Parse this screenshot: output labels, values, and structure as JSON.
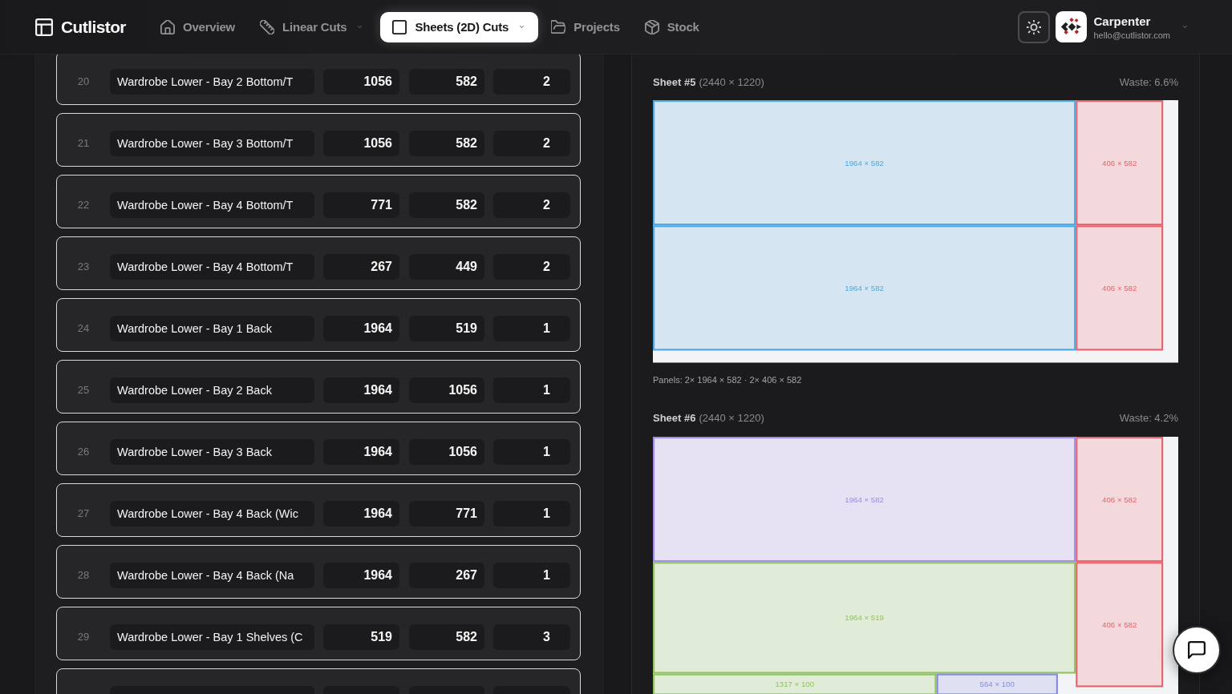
{
  "app": {
    "name": "Cutlistor"
  },
  "nav": [
    {
      "label": "Overview",
      "selected": false,
      "has_menu": false
    },
    {
      "label": "Linear Cuts",
      "selected": false,
      "has_menu": true
    },
    {
      "label": "Sheets (2D) Cuts",
      "selected": true,
      "has_menu": true
    },
    {
      "label": "Projects",
      "selected": false,
      "has_menu": false
    },
    {
      "label": "Stock",
      "selected": false,
      "has_menu": false
    }
  ],
  "user": {
    "name": "Carpenter",
    "email": "hello@cutlistor.com"
  },
  "cut_list": {
    "rows": [
      {
        "kind": "full",
        "number": "20",
        "column_1": "Wardrobe Lower - Bay 2 Bottom/T",
        "column_2": "1056",
        "column_3": "582",
        "column_4": "2"
      },
      {
        "kind": "full",
        "number": "21",
        "column_1": "Wardrobe Lower - Bay 3 Bottom/T",
        "column_2": "1056",
        "column_3": "582",
        "column_4": "2"
      },
      {
        "kind": "full",
        "number": "22",
        "column_1": "Wardrobe Lower - Bay 4 Bottom/T",
        "column_2": "771",
        "column_3": "582",
        "column_4": "2"
      },
      {
        "kind": "full",
        "number": "23",
        "column_1": "Wardrobe Lower - Bay 4 Bottom/T",
        "column_2": "267",
        "column_3": "449",
        "column_4": "2"
      },
      {
        "kind": "full",
        "number": "24",
        "column_1": "Wardrobe Lower - Bay 1 Back",
        "column_2": "1964",
        "column_3": "519",
        "column_4": "1"
      },
      {
        "kind": "full",
        "number": "25",
        "column_1": "Wardrobe Lower - Bay 2 Back",
        "column_2": "1964",
        "column_3": "1056",
        "column_4": "1"
      },
      {
        "kind": "full",
        "number": "26",
        "column_1": "Wardrobe Lower - Bay 3 Back",
        "column_2": "1964",
        "column_3": "1056",
        "column_4": "1"
      },
      {
        "kind": "full",
        "number": "27",
        "column_1": "Wardrobe Lower - Bay 4 Back (Wic",
        "column_2": "1964",
        "column_3": "771",
        "column_4": "1"
      },
      {
        "kind": "full",
        "number": "28",
        "column_1": "Wardrobe Lower - Bay 4 Back (Na",
        "column_2": "1964",
        "column_3": "267",
        "column_4": "1"
      },
      {
        "kind": "full",
        "number": "29",
        "column_1": "Wardrobe Lower - Bay 1 Shelves (C",
        "column_2": "519",
        "column_3": "582",
        "column_4": "3"
      },
      {
        "kind": "cut_off"
      }
    ]
  },
  "sheets": [
    {
      "title": "Sheet #5",
      "size": "(2440 × 1220)",
      "waste": "Waste: 6.6%",
      "columns": [
        {
          "rows": [
            {
              "panels": [
                {
                  "label": "1964 × 582",
                  "color": "#4fa8e0"
                }
              ]
            },
            {
              "panels": [
                {
                  "label": "1964 × 582",
                  "color": "#4fa8e0"
                }
              ]
            }
          ]
        },
        {
          "rows": [
            {
              "panels": [
                {
                  "label": "406 × 582",
                  "color": "#e5646e"
                }
              ]
            },
            {
              "panels": [
                {
                  "label": "406 × 582",
                  "color": "#e5646e"
                }
              ]
            }
          ]
        }
      ],
      "summary": "Panels: 2× 1964 × 582 · 2× 406 × 582"
    },
    {
      "title": "Sheet #6",
      "size": "(2440 × 1220)",
      "waste": "Waste: 4.2%",
      "columns": [
        {
          "rows": [
            {
              "panels": [
                {
                  "label": "1964 × 582",
                  "color": "#a48be6"
                }
              ]
            },
            {
              "panels": [
                {
                  "label": "1964 × 519",
                  "color": "#8fc45e"
                }
              ]
            },
            {
              "panels": [
                {
                  "label": "1317 × 100",
                  "color": "#8fc45e"
                },
                {
                  "label": "564 × 100",
                  "color": "#858ce0"
                }
              ]
            }
          ]
        },
        {
          "rows": [
            {
              "panels": [
                {
                  "label": "406 × 582",
                  "color": "#e5646e"
                }
              ]
            },
            {
              "panels": [
                {
                  "label": "406 × 582",
                  "color": "#e5646e"
                }
              ]
            }
          ]
        }
      ]
    }
  ]
}
